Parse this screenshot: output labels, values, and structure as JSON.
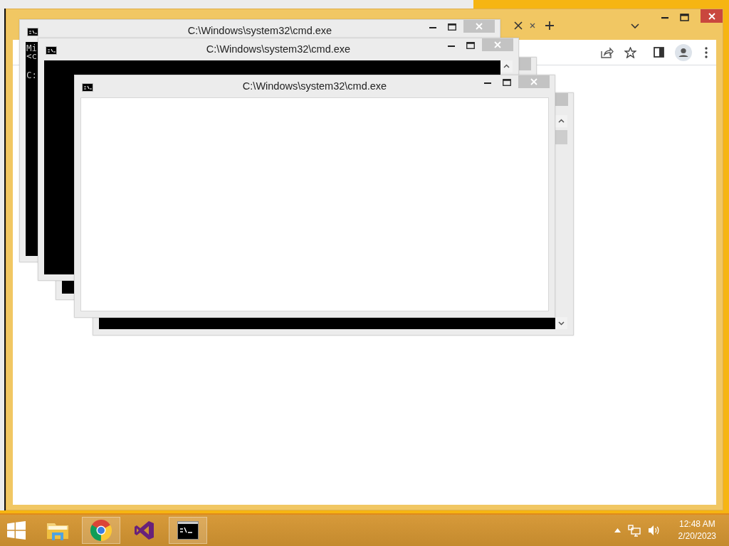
{
  "console_windows": [
    {
      "kind": "console"
    },
    {
      "title": "C:\\Windows\\system32\\cmd.exe",
      "kind": "console",
      "paragraphs": [
        {
          "lines": [
            "Mi",
            "<c"
          ]
        },
        {
          "lines": [
            "C:"
          ]
        }
      ]
    },
    {
      "title": "C:\\Windows\\system32\\cmd.exe",
      "kind": "console",
      "scrollbar": {
        "kind": "top"
      }
    },
    {
      "kind": "console",
      "scrollbar": {
        "kind": "full"
      }
    },
    {
      "title": "C:\\Windows\\system32\\cmd.exe",
      "kind": "blank",
      "scrollbar": false
    }
  ],
  "taskbar": {
    "apps": [
      {
        "kind": "explorer",
        "selected": false
      },
      {
        "kind": "chrome",
        "selected": true
      },
      {
        "kind": "visual-studio",
        "selected": false
      },
      {
        "kind": "console",
        "selected": true
      }
    ],
    "clock": {
      "time": "12:48 AM",
      "date": "2/20/2023"
    }
  }
}
